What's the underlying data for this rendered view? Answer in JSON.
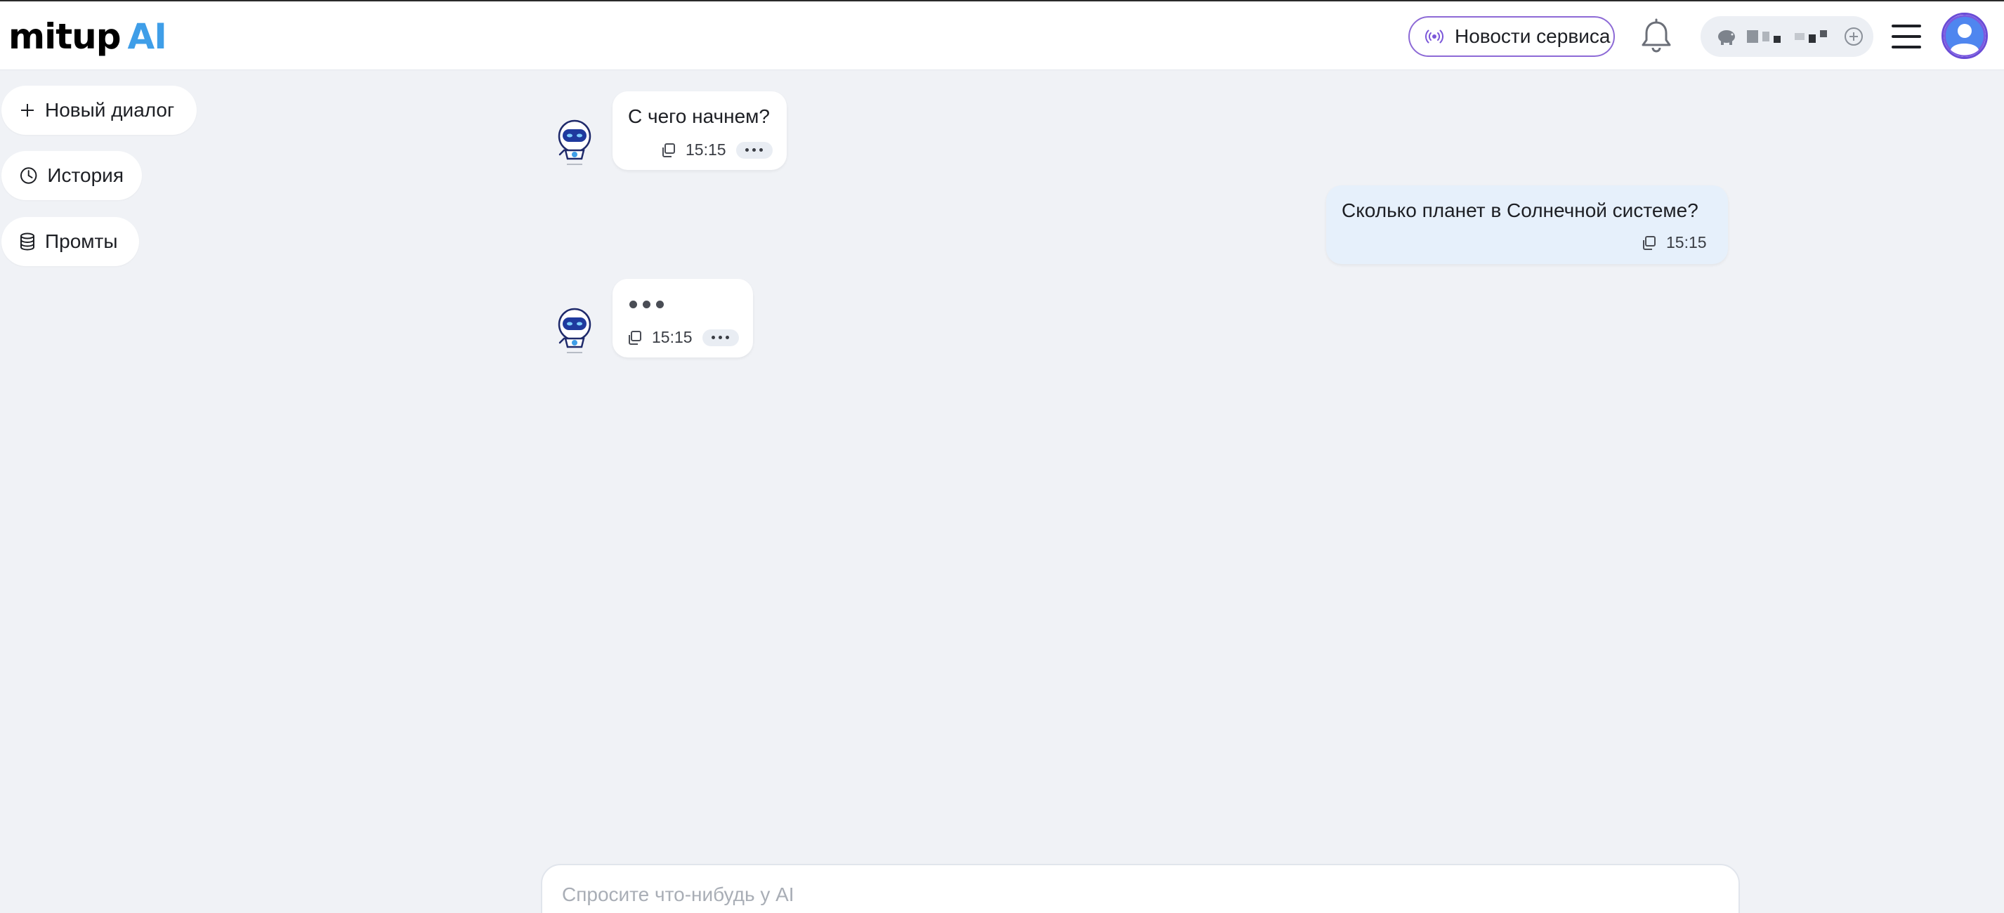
{
  "header": {
    "logo_main": "mitup",
    "logo_ai": "AI",
    "news_button": "Новости сервиса",
    "accent_color": "#6a4cd6",
    "logo_ai_color": "#3f9ee8"
  },
  "sidebar": {
    "new_dialog": "Новый диалог",
    "history": "История",
    "prompts": "Промты"
  },
  "messages": [
    {
      "role": "assistant",
      "text": "С чего начнем?",
      "time": "15:15"
    },
    {
      "role": "user",
      "text": "Сколько планет в Солнечной системе?",
      "time": "15:15"
    },
    {
      "role": "assistant",
      "text": "",
      "typing": true,
      "time": "15:15"
    }
  ],
  "composer": {
    "placeholder": "Спросите что-нибудь у AI",
    "value": ""
  },
  "colors": {
    "background": "#f0f2f6",
    "user_bubble": "#e6f0fb",
    "assistant_bubble": "#ffffff"
  }
}
